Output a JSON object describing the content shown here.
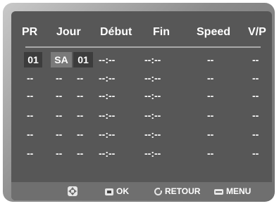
{
  "header": {
    "pr": "PR",
    "jour": "Jour",
    "debut": "Début",
    "fin": "Fin",
    "speed": "Speed",
    "vp": "V/P"
  },
  "rows": [
    {
      "pr": "01",
      "jour": "SA",
      "date": "01",
      "debut": "--:--",
      "fin": "--:--",
      "speed": "--",
      "vp": "--"
    },
    {
      "pr": "--",
      "jour": "--",
      "date": "--",
      "debut": "--:--",
      "fin": "--:--",
      "speed": "--",
      "vp": "--"
    },
    {
      "pr": "--",
      "jour": "--",
      "date": "--",
      "debut": "--:--",
      "fin": "--:--",
      "speed": "--",
      "vp": "--"
    },
    {
      "pr": "--",
      "jour": "--",
      "date": "--",
      "debut": "--:--",
      "fin": "--:--",
      "speed": "--",
      "vp": "--"
    },
    {
      "pr": "--",
      "jour": "--",
      "date": "--",
      "debut": "--:--",
      "fin": "--:--",
      "speed": "--",
      "vp": "--"
    },
    {
      "pr": "--",
      "jour": "--",
      "date": "--",
      "debut": "--:--",
      "fin": "--:--",
      "speed": "--",
      "vp": "--"
    }
  ],
  "footer": {
    "nav_icon": "direction-pad-icon",
    "ok_icon": "enter-key-icon",
    "ok_label": "OK",
    "return_icon": "return-icon",
    "return_label": "RETOUR",
    "menu_icon": "menu-key-icon",
    "menu_label": "MENU"
  },
  "colors": {
    "screen": "#575757",
    "selected_cell": "#7a7a7a",
    "edit_cell": "#3c3c3c",
    "footer": "#6f6f6f",
    "text": "#ffffff"
  }
}
